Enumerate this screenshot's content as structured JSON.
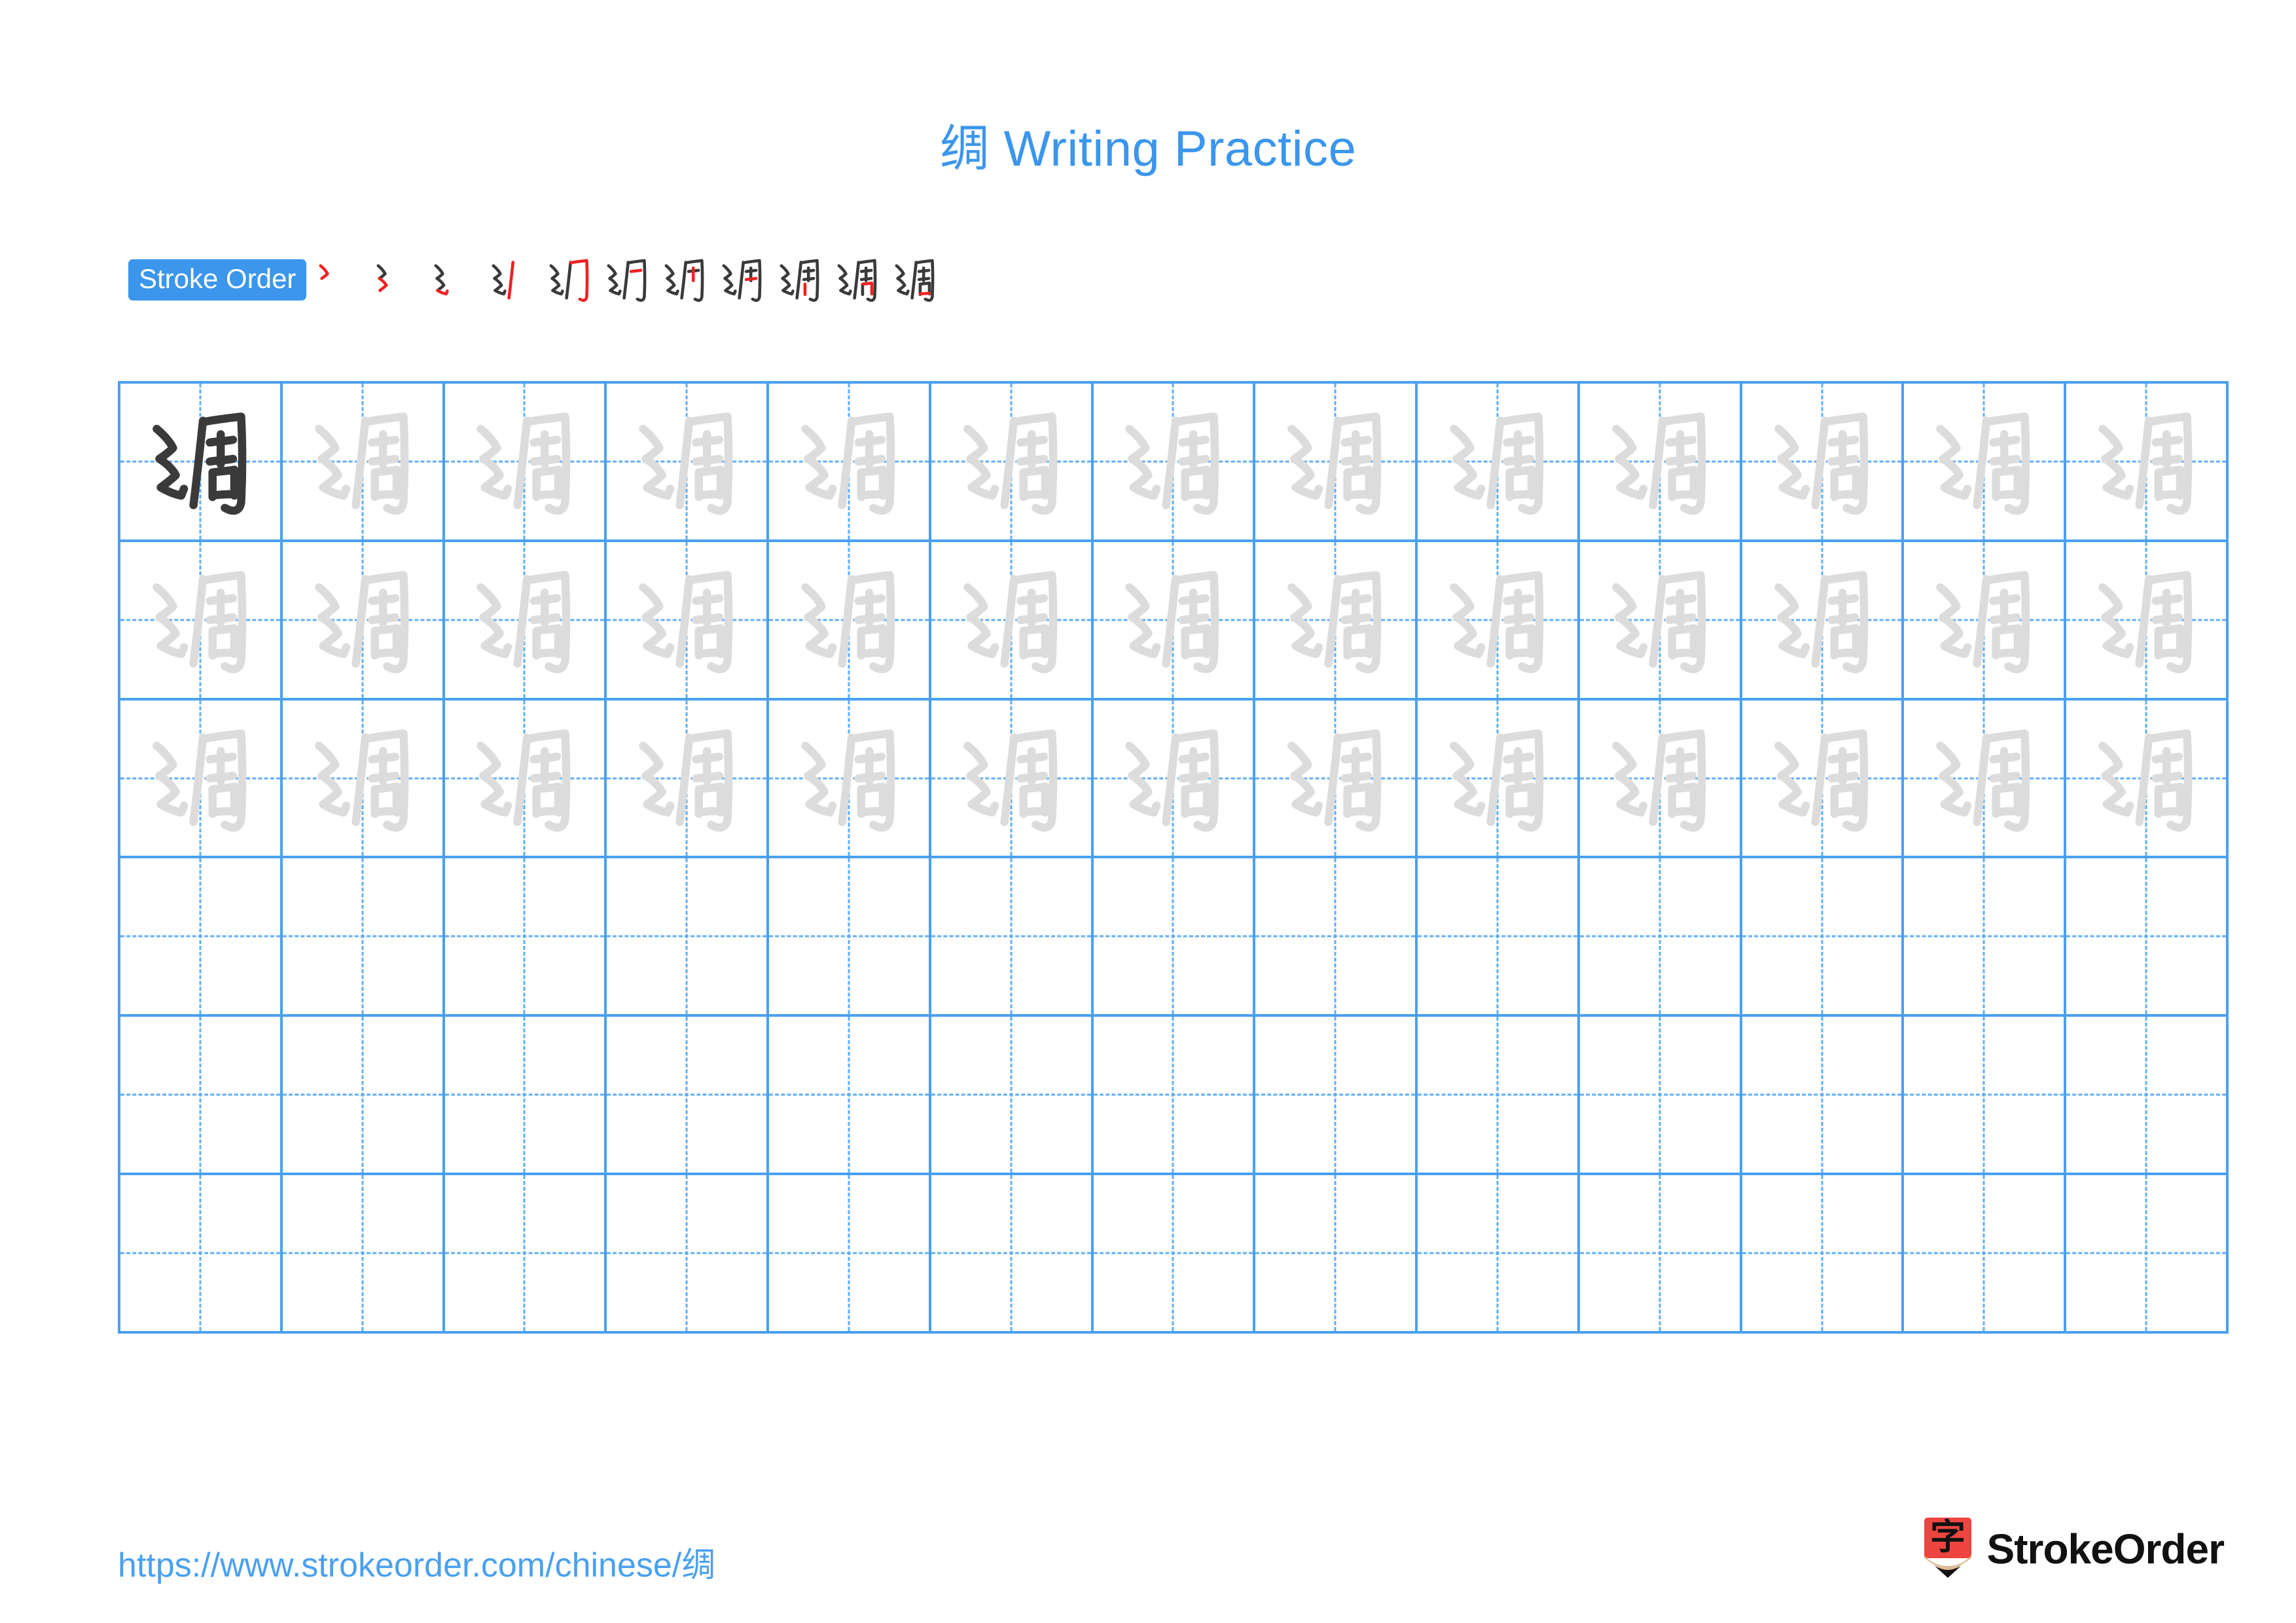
{
  "page": {
    "character": "绸",
    "title": "绸 Writing Practice",
    "title_character": "绸",
    "title_text": "Writing Practice",
    "background_color": "#ffffff",
    "accent_blue": "#3B96EC",
    "grid_line_color": "#4AA0F0",
    "guide_line_color": "#62AEF4",
    "stroke_new_color": "#EE2222",
    "stroke_done_color": "#3A3A3A",
    "tracing_gray": "#DCDCDC"
  },
  "stroke_order": {
    "badge_label": "Stroke Order",
    "total_strokes": 11,
    "steps": [
      {
        "index": 1,
        "strokes_shown": 1,
        "new_stroke": 1
      },
      {
        "index": 2,
        "strokes_shown": 2,
        "new_stroke": 2
      },
      {
        "index": 3,
        "strokes_shown": 3,
        "new_stroke": 3
      },
      {
        "index": 4,
        "strokes_shown": 4,
        "new_stroke": 4
      },
      {
        "index": 5,
        "strokes_shown": 5,
        "new_stroke": 5
      },
      {
        "index": 6,
        "strokes_shown": 6,
        "new_stroke": 6
      },
      {
        "index": 7,
        "strokes_shown": 7,
        "new_stroke": 7
      },
      {
        "index": 8,
        "strokes_shown": 8,
        "new_stroke": 8
      },
      {
        "index": 9,
        "strokes_shown": 9,
        "new_stroke": 9
      },
      {
        "index": 10,
        "strokes_shown": 10,
        "new_stroke": 10
      },
      {
        "index": 11,
        "strokes_shown": 11,
        "new_stroke": 11
      }
    ]
  },
  "grid": {
    "columns": 13,
    "rows": 6,
    "filled_rows": 3,
    "empty_rows": 3,
    "first_cell_style": "dark",
    "tracing_cell_style": "light",
    "cell_character": "绸"
  },
  "footer": {
    "url": "https://www.strokeorder.com/chinese/绸",
    "brand_name": "StrokeOrder",
    "brand_mark_character": "字",
    "brand_mark_color": "#EE4540",
    "brand_mark_wood_color": "#DDBC97",
    "brand_mark_tip_color": "#111111"
  }
}
